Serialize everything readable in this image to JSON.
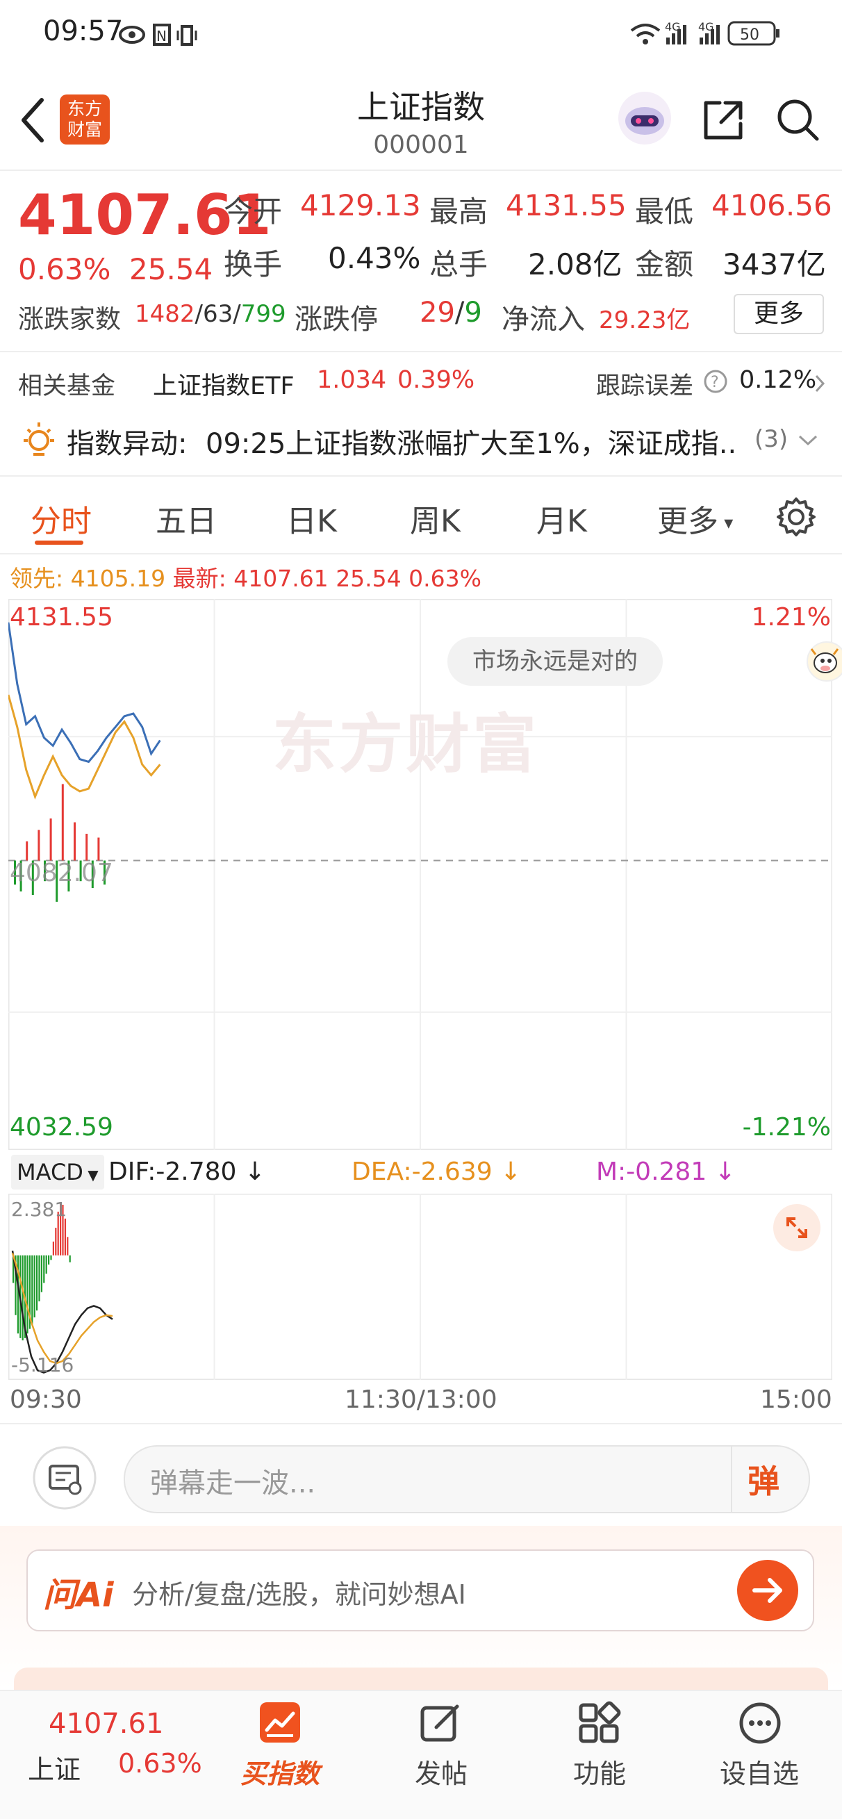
{
  "status_bar": {
    "time": "09:57",
    "battery": "50",
    "network_1": "4G",
    "network_2": "4G"
  },
  "header": {
    "logo_text": "东方财富",
    "title": "上证指数",
    "code": "000001"
  },
  "quote": {
    "price": "4107.61",
    "change_pct": "0.63%",
    "change_abs": "25.54",
    "open_label": "今开",
    "open": "4129.13",
    "high_label": "最高",
    "high": "4131.55",
    "low_label": "最低",
    "low": "4106.56",
    "turnover_label": "换手",
    "turnover": "0.43%",
    "volume_label": "总手",
    "volume": "2.08亿",
    "amount_label": "金额",
    "amount": "3437亿",
    "breadth_label": "涨跌家数",
    "breadth_up": "1482",
    "breadth_flat": "/63/",
    "breadth_down": "799",
    "limit_label": "涨跌停",
    "limit_up": "29",
    "limit_sep": "/",
    "limit_down": "9",
    "inflow_label": "净流入",
    "inflow": "29.23亿",
    "more_button": "更多"
  },
  "fund_row": {
    "label": "相关基金",
    "fund_name": "上证指数ETF",
    "fund_price": "1.034",
    "fund_change": "0.39%",
    "tracking_label": "跟踪误差",
    "tracking_value": "0.12%"
  },
  "alert_row": {
    "label": "指数异动:",
    "text": "09:25上证指数涨幅扩大至1%，深证成指...",
    "count": "(3)"
  },
  "tabs": {
    "items": [
      "分时",
      "五日",
      "日K",
      "周K",
      "月K",
      "更多"
    ],
    "active": "分时"
  },
  "chart_info": {
    "lead_label": "领先:",
    "lead_value": "4105.19",
    "latest_label": "最新:",
    "latest_value": "4107.61",
    "latest_change": "25.54",
    "latest_pct": "0.63%",
    "watermark": "东方财富",
    "slogan": "市场永远是对的",
    "mid_overlay": "4082.07"
  },
  "chart_data": [
    {
      "type": "line",
      "title": "",
      "x_ticks": [
        "09:30",
        "11:30/13:00",
        "15:00"
      ],
      "y_top_label": "4131.55",
      "y_bottom_label": "4032.59",
      "y_top_pct": "1.21%",
      "y_bottom_pct": "-1.21%",
      "ylim": [
        4032.59,
        4131.55
      ],
      "reference_value": 4082.07,
      "series": [
        {
          "color": "#3b6fb6",
          "values": [
            4129.5,
            4118.0,
            4110.5,
            4112.0,
            4108.0,
            4106.5,
            4109.5,
            4107.0,
            4104.0,
            4103.5,
            4105.5,
            4108.0,
            4110.0,
            4112.0,
            4112.5,
            4110.0,
            4105.0,
            4107.5
          ]
        },
        {
          "color": "#e6a22a",
          "values": [
            4116.0,
            4110.0,
            4102.0,
            4097.0,
            4101.0,
            4104.5,
            4101.0,
            4099.0,
            4098.0,
            4098.5,
            4102.0,
            4105.5,
            4109.0,
            4111.0,
            4108.0,
            4103.0,
            4101.0,
            4103.0
          ]
        }
      ],
      "volume_bars": [
        {
          "dir": "down",
          "v": 0.35
        },
        {
          "dir": "down",
          "v": 0.45
        },
        {
          "dir": "up",
          "v": 0.25
        },
        {
          "dir": "down",
          "v": 0.5
        },
        {
          "dir": "up",
          "v": 0.4
        },
        {
          "dir": "down",
          "v": 0.3
        },
        {
          "dir": "up",
          "v": 0.55
        },
        {
          "dir": "down",
          "v": 0.6
        },
        {
          "dir": "up",
          "v": 1.0
        },
        {
          "dir": "down",
          "v": 0.45
        },
        {
          "dir": "up",
          "v": 0.5
        },
        {
          "dir": "down",
          "v": 0.3
        },
        {
          "dir": "up",
          "v": 0.35
        },
        {
          "dir": "down",
          "v": 0.4
        },
        {
          "dir": "up",
          "v": 0.3
        },
        {
          "dir": "down",
          "v": 0.35
        }
      ]
    },
    {
      "type": "bar",
      "title": "MACD",
      "indicator_label": "MACD",
      "dif_label": "DIF:-2.780",
      "dea_label": "DEA:-2.639",
      "m_label": "M:-0.281",
      "y_top_label": "2.381",
      "y_bottom_label": "-5.116",
      "ylim": [
        -5.116,
        2.381
      ],
      "histogram": [
        -1.2,
        -2.6,
        -3.4,
        -3.6,
        -3.7,
        -3.6,
        -3.4,
        -3.2,
        -3.0,
        -2.7,
        -2.4,
        -2.0,
        -1.6,
        -1.2,
        -0.8,
        -0.4,
        -0.2,
        0.6,
        1.2,
        1.9,
        2.3,
        2.2,
        1.6,
        0.8,
        -0.3
      ],
      "dif": [
        0.2,
        -1.5,
        -3.2,
        -4.4,
        -5.0,
        -5.1,
        -5.0,
        -4.7,
        -4.2,
        -3.6,
        -3.0,
        -2.6,
        -2.3,
        -2.2,
        -2.3,
        -2.6,
        -2.78
      ],
      "dea": [
        0.1,
        -0.8,
        -1.9,
        -2.9,
        -3.7,
        -4.2,
        -4.6,
        -4.7,
        -4.6,
        -4.3,
        -3.9,
        -3.5,
        -3.2,
        -2.9,
        -2.7,
        -2.6,
        -2.639
      ]
    }
  ],
  "comment_bar": {
    "placeholder": "弹幕走一波...",
    "danmu_button": "弹"
  },
  "ai_bar": {
    "logo": "问Ai",
    "placeholder": "分析/复盘/选股，就问妙想AI"
  },
  "bottom_nav": {
    "index_price": "4107.61",
    "index_name": "上证",
    "index_pct": "0.63%",
    "buy_label": "买指数",
    "post_label": "发帖",
    "func_label": "功能",
    "watch_label": "设自选"
  },
  "colors": {
    "brand": "#e8531d",
    "up": "#e53935",
    "down": "#1e9b2c",
    "price_line": "#3b6fb6",
    "avg_line": "#e6a22a"
  }
}
